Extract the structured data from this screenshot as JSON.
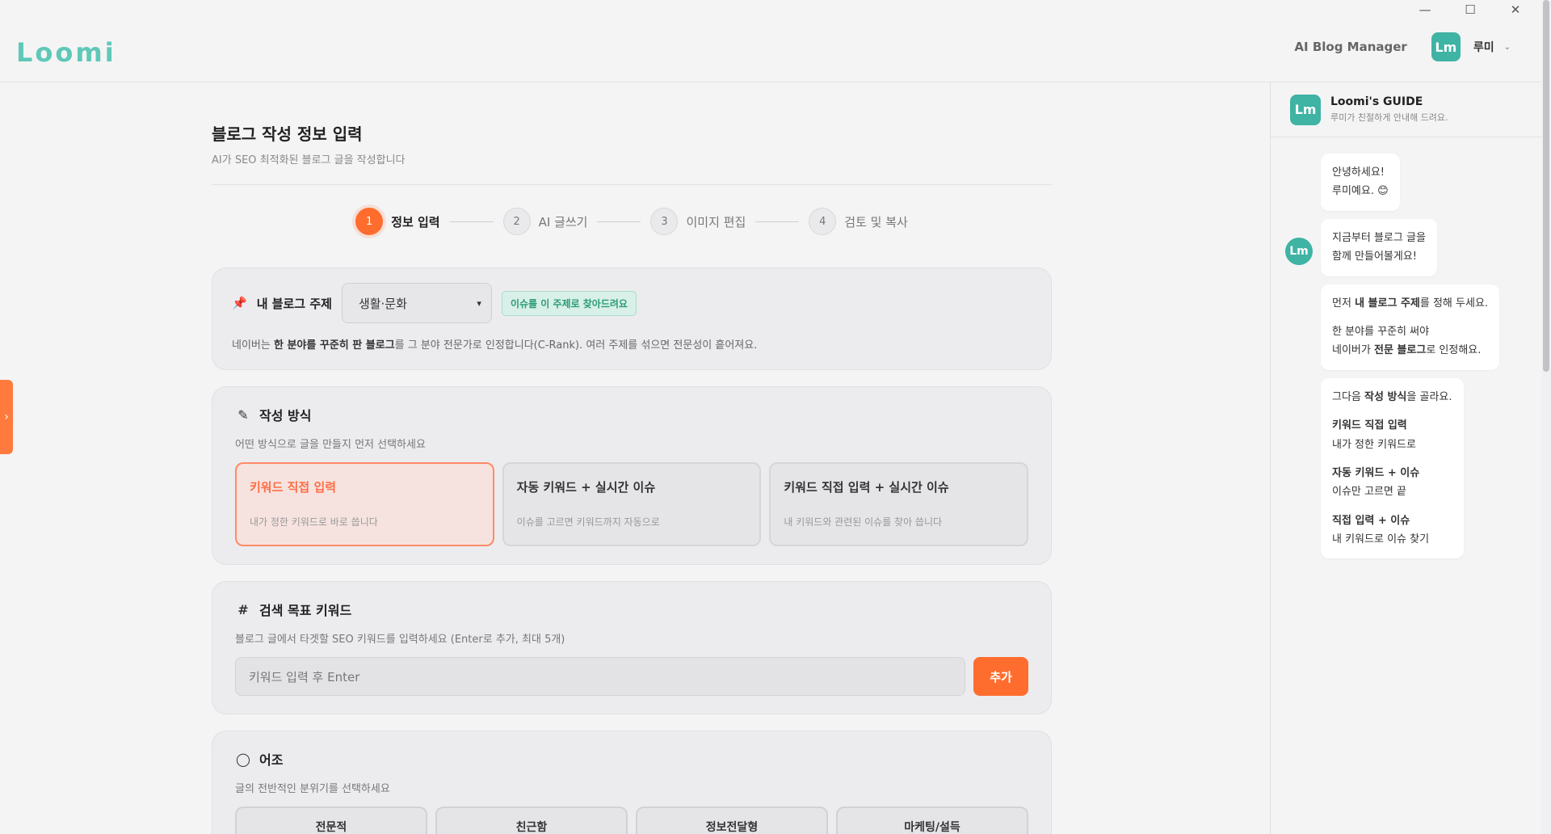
{
  "window": {
    "minimize": "—",
    "maximize": "☐",
    "close": "✕"
  },
  "header": {
    "logo": "Loomi",
    "app_name": "AI Blog Manager",
    "avatar_text": "Lm",
    "user_name": "루미",
    "chevron": "⌄"
  },
  "drawer": {
    "chevron": "›"
  },
  "page": {
    "title": "블로그 작성 정보 입력",
    "subtitle": "AI가 SEO 최적화된 블로그 글을 작성합니다"
  },
  "steps": [
    {
      "num": "1",
      "label": "정보 입력",
      "active": true
    },
    {
      "num": "2",
      "label": "AI 글쓰기",
      "active": false
    },
    {
      "num": "3",
      "label": "이미지 편집",
      "active": false
    },
    {
      "num": "4",
      "label": "검토 및 복사",
      "active": false
    }
  ],
  "topic": {
    "label": "내 블로그 주제",
    "selected": "생활·문화",
    "badge": "이슈를 이 주제로 찾아드려요",
    "note_pre": "네이버는 ",
    "note_bold": "한 분야를 꾸준히 판 블로그",
    "note_post": "를 그 분야 전문가로 인정합니다(C-Rank). 여러 주제를 섞으면 전문성이 흩어져요."
  },
  "mode": {
    "title": "작성 방식",
    "subtitle": "어떤 방식으로 글을 만들지 먼저 선택하세요",
    "options": [
      {
        "title": "키워드 직접 입력",
        "desc": "내가 정한 키워드로 바로 씁니다"
      },
      {
        "title": "자동 키워드 + 실시간 이슈",
        "desc": "이슈를 고르면 키워드까지 자동으로"
      },
      {
        "title": "키워드 직접 입력 + 실시간 이슈",
        "desc": "내 키워드와 관련된 이슈를 찾아 씁니다"
      }
    ]
  },
  "keyword": {
    "title": "검색 목표 키워드",
    "subtitle": "블로그 글에서 타겟할 SEO 키워드를 입력하세요 (Enter로 추가, 최대 5개)",
    "placeholder": "키워드 입력 후 Enter",
    "add_label": "추가"
  },
  "tone": {
    "title": "어조",
    "subtitle": "글의 전반적인 분위기를 선택하세요",
    "options": [
      "전문적",
      "친근함",
      "정보전달형",
      "마케팅/설득"
    ]
  },
  "guide": {
    "title": "Loomi's GUIDE",
    "subtitle": "루미가 친절하게 안내해 드려요.",
    "avatar_text": "Lm",
    "b1_l1": "안녕하세요!",
    "b1_l2": "루미예요. 😊",
    "b2_l1": "지금부터 블로그 글을",
    "b2_l2": "함께 만들어볼게요!",
    "b3_pre": "먼저 ",
    "b3_bold": "내 블로그 주제",
    "b3_post": "를 정해 두세요.",
    "b3_l2": "한 분야를 꾸준히 써야",
    "b3_l3_pre": "네이버가 ",
    "b3_l3_bold": "전문 블로그",
    "b3_l3_post": "로 인정해요.",
    "b4_pre": "그다음 ",
    "b4_bold": "작성 방식",
    "b4_post": "을 골라요.",
    "b4_o1_title": "키워드 직접 입력",
    "b4_o1_desc": "내가 정한 키워드로",
    "b4_o2_title": "자동 키워드 + 이슈",
    "b4_o2_desc": "이슈만 고르면 끝",
    "b4_o3_title": "직접 입력 + 이슈",
    "b4_o3_desc": "내 키워드로 이슈 찾기"
  }
}
